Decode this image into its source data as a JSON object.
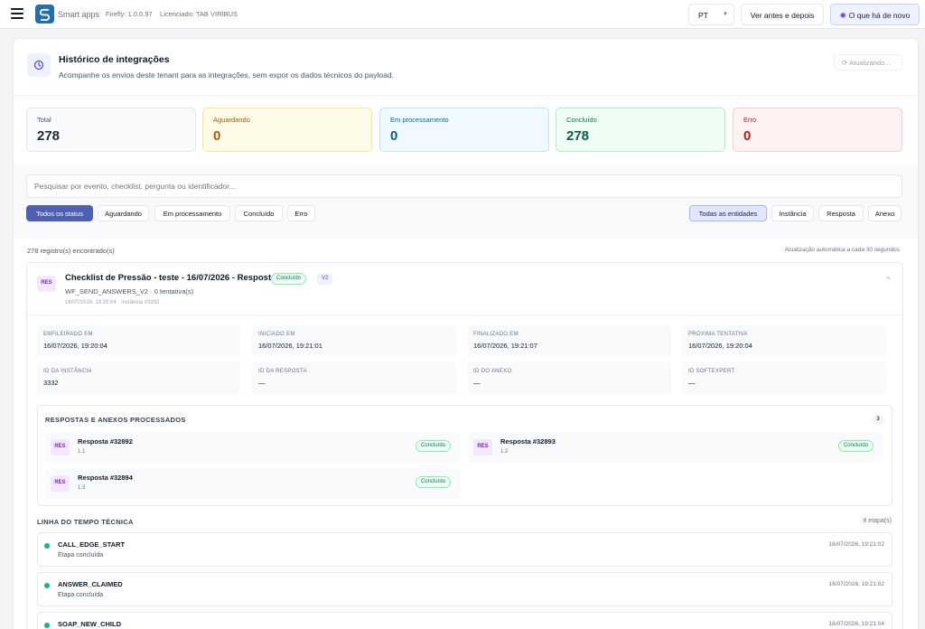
{
  "topbar": {
    "brand": "Smart apps",
    "version": "Firefly: 1.0.0.97",
    "license": "Licenciado: TAB VIRIBUS",
    "language": "PT",
    "before_after_label": "Ver antes e depois",
    "whats_new_label": "O que há de novo"
  },
  "header": {
    "title": "Histórico de integrações",
    "subtitle": "Acompanhe os envios deste tenant para as integrações, sem expor os dados técnicos do payload.",
    "refresh_label": "Atualizando..."
  },
  "stats": [
    {
      "label": "Total",
      "value": "278"
    },
    {
      "label": "Aguardando",
      "value": "0"
    },
    {
      "label": "Em processamento",
      "value": "0"
    },
    {
      "label": "Concluído",
      "value": "278"
    },
    {
      "label": "Erro",
      "value": "0"
    }
  ],
  "search": {
    "placeholder": "Pesquisar por evento, checklist, pergunta ou identificador..."
  },
  "status_filters": [
    "Todos os status",
    "Aguardando",
    "Em processamento",
    "Concluído",
    "Erro"
  ],
  "entity_filters": [
    "Todas as entidades",
    "Instância",
    "Resposta",
    "Anexo"
  ],
  "results": {
    "count_text": "278 registro(s) encontrado(s)",
    "auto_refresh_text": "Atualização automática a cada 30 segundos"
  },
  "record": {
    "badge": "RES",
    "title": "Checklist de Pressão - teste - 16/07/2026 - Resposta",
    "status": "Concluído",
    "version": "V2",
    "event": "WF_SEND_ANSWERS_V2 · 0 tentativa(s)",
    "meta": "16/07/2026, 19:20:04 · Instância #3332",
    "fields": [
      {
        "key": "ENFILEIRADO EM",
        "value": "16/07/2026, 19:20:04"
      },
      {
        "key": "INICIADO EM",
        "value": "16/07/2026, 19:21:01"
      },
      {
        "key": "FINALIZADO EM",
        "value": "16/07/2026, 19:21:07"
      },
      {
        "key": "PRÓXIMA TENTATIVA",
        "value": "16/07/2026, 19:20:04"
      },
      {
        "key": "ID DA INSTÂNCIA",
        "value": "3332"
      },
      {
        "key": "ID DA RESPOSTA",
        "value": "—"
      },
      {
        "key": "ID DO ANEXO",
        "value": "—"
      },
      {
        "key": "ID SOFTEXPERT",
        "value": "—"
      }
    ],
    "processed": {
      "title": "RESPOSTAS E ANEXOS PROCESSADOS",
      "count": "3",
      "items": [
        {
          "badge": "RES",
          "name": "Resposta #32892",
          "number": "1.1",
          "status": "Concluído"
        },
        {
          "badge": "RES",
          "name": "Resposta #32893",
          "number": "1.2",
          "status": "Concluído"
        },
        {
          "badge": "RES",
          "name": "Resposta #32894",
          "number": "1.3",
          "status": "Concluído"
        }
      ]
    },
    "timeline": {
      "title": "LINHA DO TEMPO TÉCNICA",
      "count": "8 etapa(s)",
      "steps": [
        {
          "name": "CALL_EDGE_START",
          "desc": "Etapa concluída",
          "time": "16/07/2026, 19:21:02"
        },
        {
          "name": "ANSWER_CLAIMED",
          "desc": "Etapa concluída",
          "time": "16/07/2026, 19:21:02"
        },
        {
          "name": "SOAP_NEW_CHILD",
          "desc": "",
          "time": "16/07/2026, 19:21:04"
        }
      ]
    }
  },
  "colors": {
    "accent": "#4f5fb4",
    "success": "#10b981",
    "brand": "#1f6fb2"
  },
  "icons": [
    "menu-icon",
    "smart-apps-logo",
    "chevron-down-icon",
    "sparkle-icon",
    "history-icon",
    "refresh-icon",
    "chevron-up-icon"
  ]
}
